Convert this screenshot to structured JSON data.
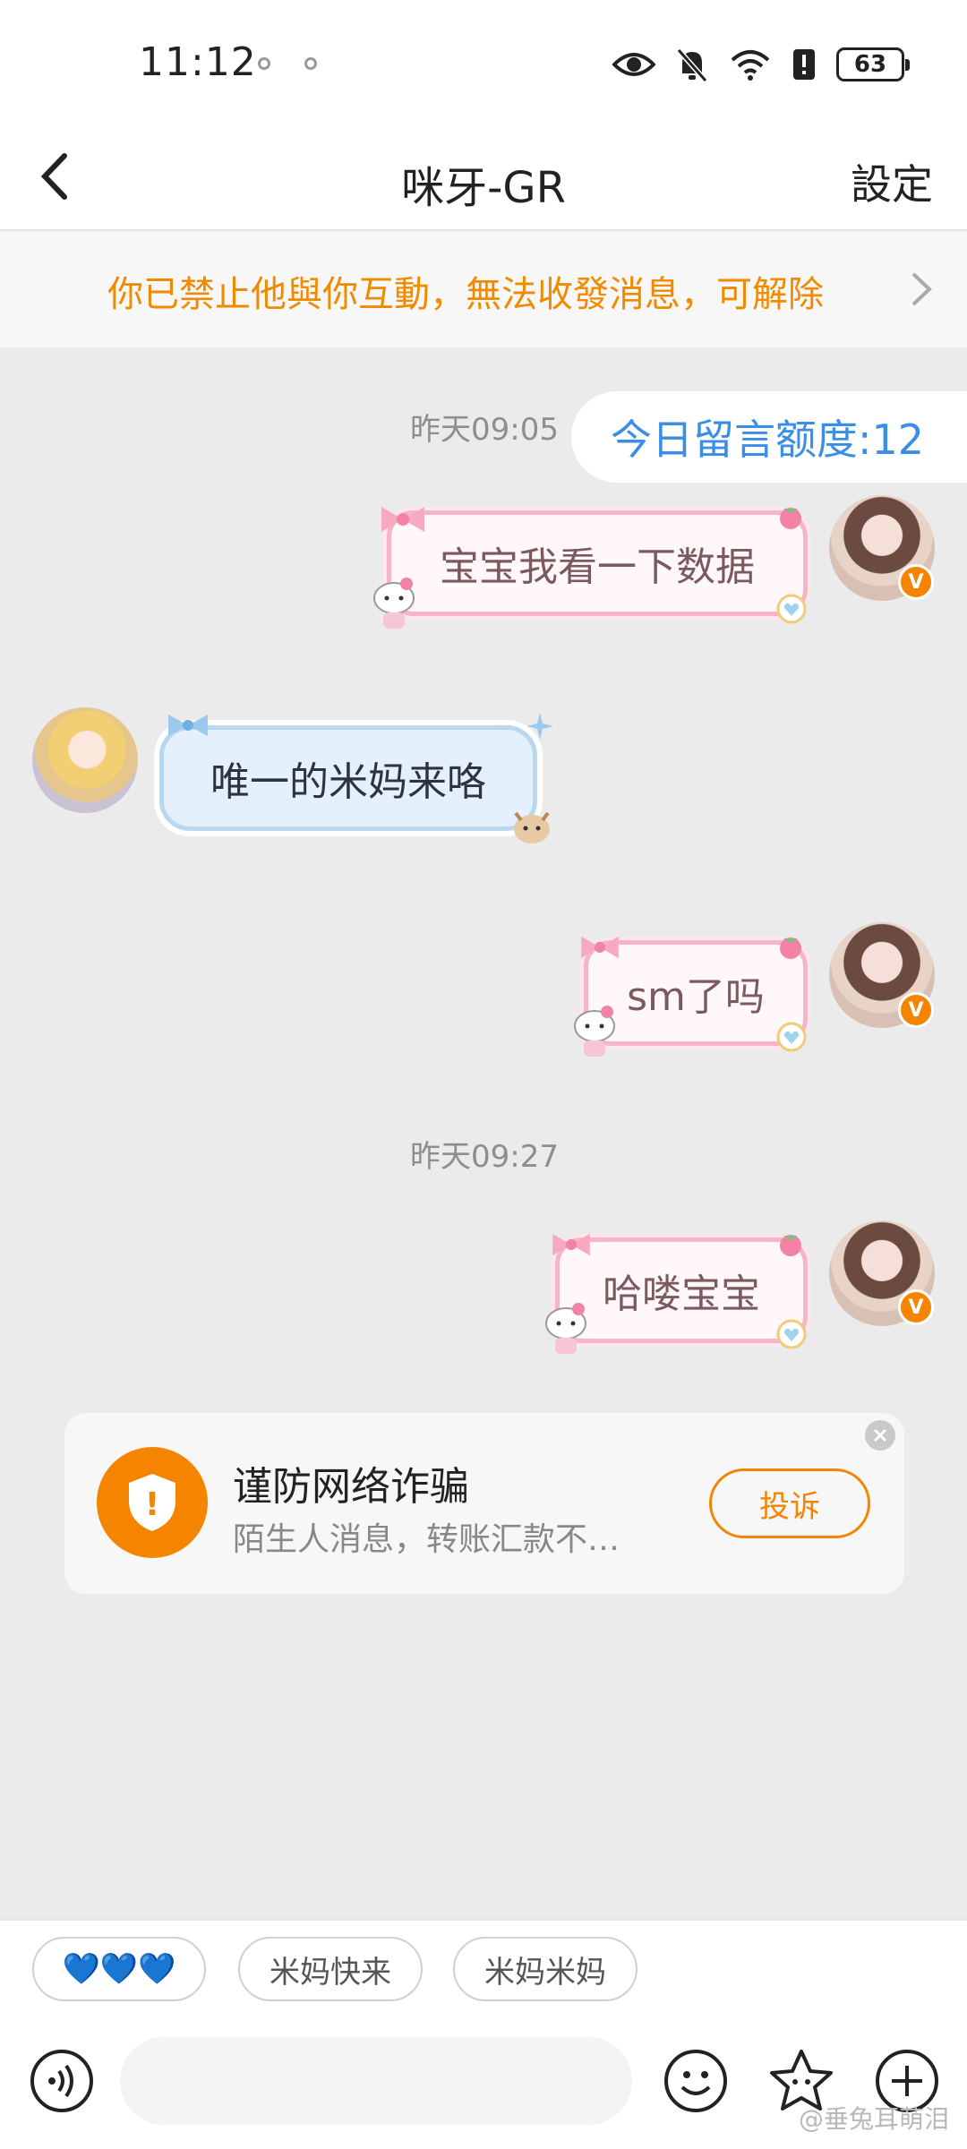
{
  "status_bar": {
    "time": "11:12",
    "battery": "63"
  },
  "nav": {
    "title": "咪牙-GR",
    "settings_label": "設定"
  },
  "block_notice": {
    "text": "你已禁止他與你互動，無法收發消息，可解除"
  },
  "messages": {
    "timestamp_1": "昨天09:05",
    "quota": "今日留言额度:12",
    "msg_1": "宝宝我看一下数据",
    "msg_2": "唯一的米妈来咯",
    "msg_3": "sm了吗",
    "timestamp_2": "昨天09:27",
    "msg_4": "哈喽宝宝"
  },
  "verified_badge": "V",
  "fraud_card": {
    "title": "谨防网络诈骗",
    "subtitle": "陌生人消息，转账汇款不…",
    "complain_label": "投诉",
    "icon_glyph": "!"
  },
  "quick_replies": [
    "💙💙💙",
    "米妈快来",
    "米妈米妈"
  ],
  "input": {
    "placeholder": ""
  },
  "watermark": "@垂兔耳萌泪",
  "colors": {
    "accent_orange": "#f58400",
    "notice_orange": "#f08a00",
    "quota_blue": "#3a8ee6",
    "pink_bubble_border": "#f4b6c7",
    "blue_bubble_fill": "#e4f0fb"
  },
  "icons": [
    "back-icon",
    "eye-icon",
    "bell-muted-icon",
    "wifi-icon",
    "alert-icon",
    "battery-icon",
    "chevron-right-icon",
    "shield-icon",
    "close-icon",
    "voice-icon",
    "emoji-icon",
    "sticker-icon",
    "plus-icon"
  ]
}
